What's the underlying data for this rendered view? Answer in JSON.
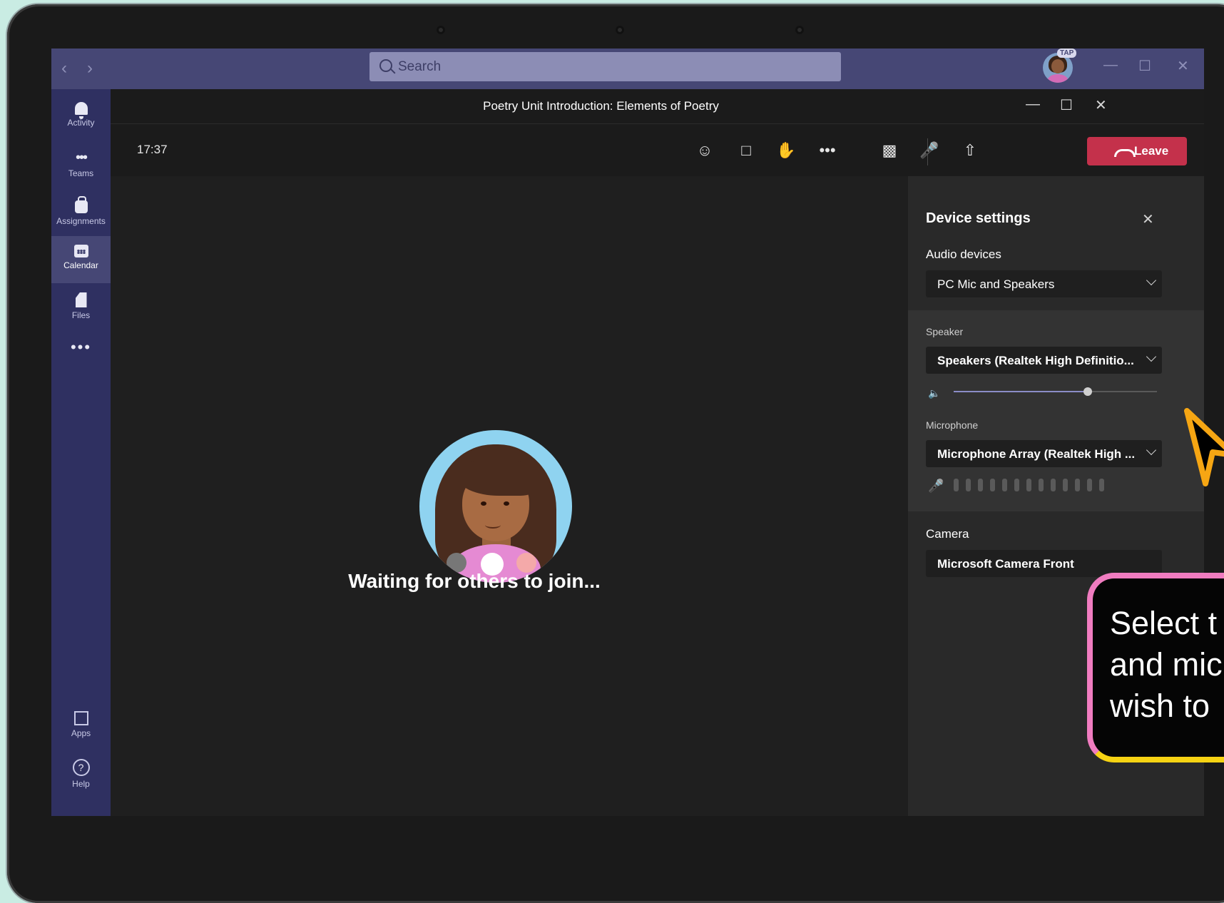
{
  "search": {
    "placeholder": "Search"
  },
  "account": {
    "badge": "TAP"
  },
  "rail": {
    "items": [
      {
        "label": "Activity"
      },
      {
        "label": "Teams"
      },
      {
        "label": "Assignments"
      },
      {
        "label": "Calendar"
      },
      {
        "label": "Files"
      }
    ],
    "more": "•••",
    "bottom": [
      {
        "label": "Apps"
      },
      {
        "label": "Help"
      }
    ],
    "active_item": "Calendar"
  },
  "meeting": {
    "title": "Poetry Unit Introduction: Elements of Poetry",
    "time": "17:37",
    "more": "•••",
    "leave_label": "Leave",
    "waiting_text": "Waiting for others to join..."
  },
  "device_settings": {
    "title": "Device settings",
    "audio_devices_label": "Audio devices",
    "audio_devices_value": "PC Mic and Speakers",
    "speaker_label": "Speaker",
    "speaker_value": "Speakers (Realtek High Definitio...",
    "speaker_volume": 0.66,
    "microphone_label": "Microphone",
    "microphone_value": "Microphone Array (Realtek High ...",
    "camera_label": "Camera",
    "camera_value": "Microsoft Camera Front"
  },
  "callout": {
    "lines": [
      "Select t",
      "and mic",
      "wish to"
    ]
  },
  "colors": {
    "brand_purple": "#464775",
    "leave_red": "#c4314b",
    "callout_pink": "#f07cc0",
    "callout_yellow": "#f6d313"
  }
}
